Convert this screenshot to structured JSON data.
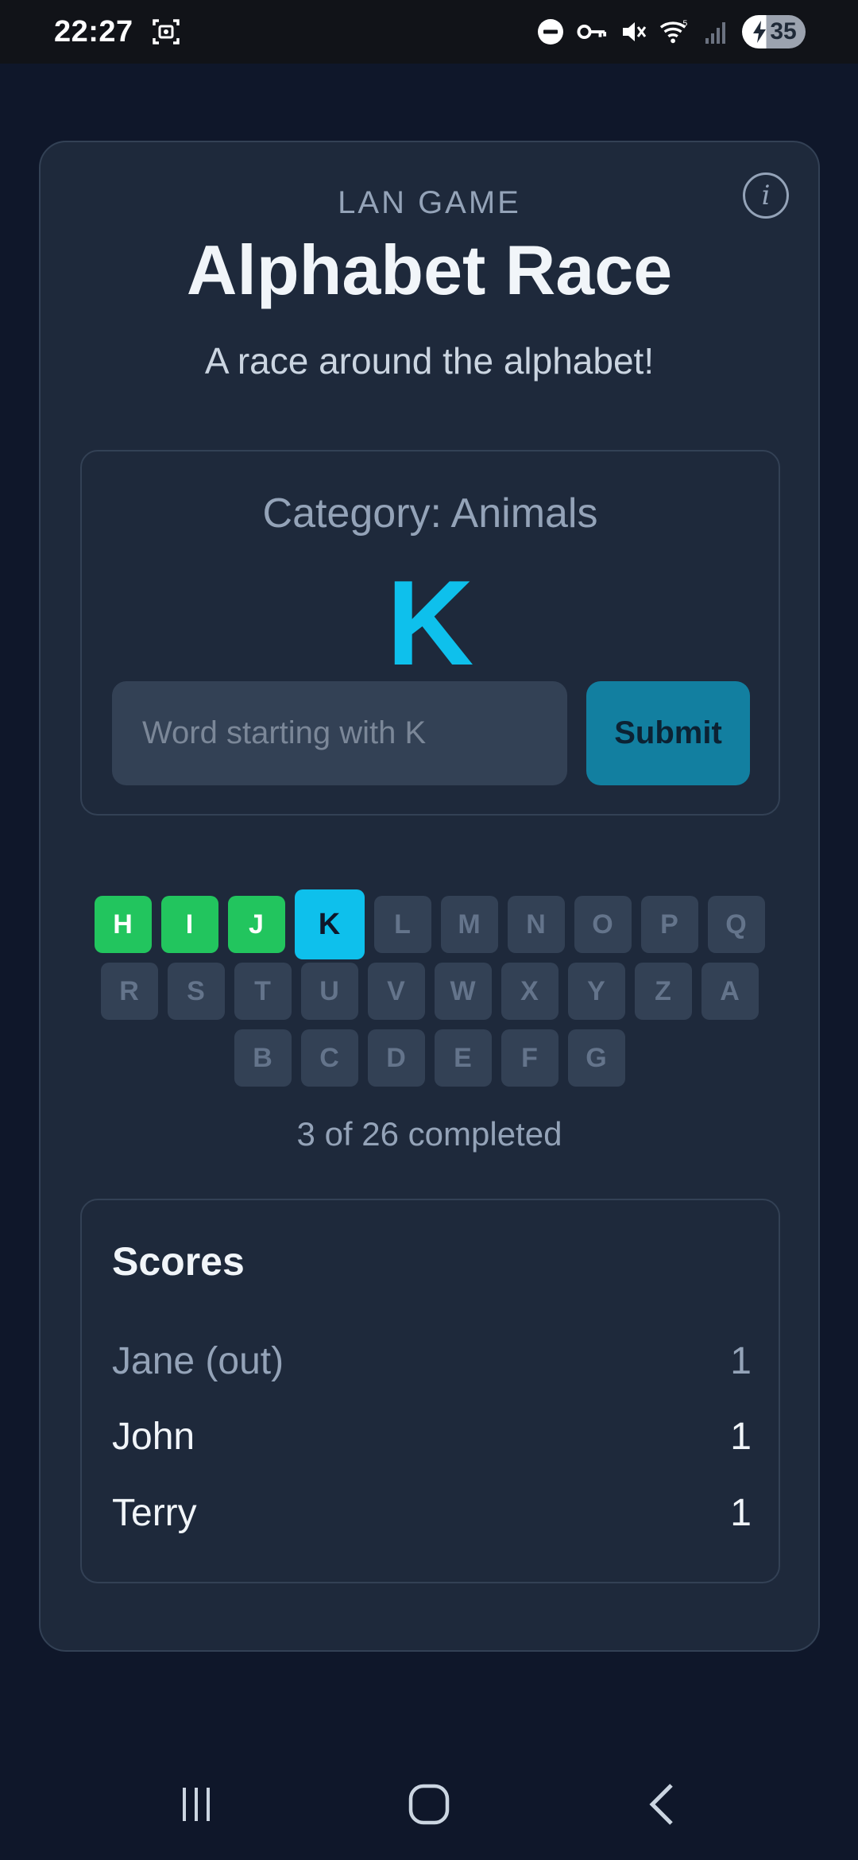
{
  "status_bar": {
    "time": "22:27",
    "battery": "35",
    "icons": [
      "screenshot-icon",
      "do-not-disturb-icon",
      "vpn-key-icon",
      "mute-icon",
      "wifi-icon",
      "signal-icon",
      "battery-charging-icon"
    ]
  },
  "header": {
    "eyebrow": "LAN GAME",
    "title": "Alphabet Race",
    "subtitle": "A race around the alphabet!",
    "info_icon": "i"
  },
  "play": {
    "category": "Category: Animals",
    "current_letter": "K",
    "input_placeholder": "Word starting with K",
    "input_value": "",
    "submit_label": "Submit"
  },
  "tracker": {
    "rows": [
      [
        {
          "letter": "H",
          "state": "done"
        },
        {
          "letter": "I",
          "state": "done"
        },
        {
          "letter": "J",
          "state": "done"
        },
        {
          "letter": "K",
          "state": "current"
        },
        {
          "letter": "L",
          "state": "pending"
        },
        {
          "letter": "M",
          "state": "pending"
        },
        {
          "letter": "N",
          "state": "pending"
        },
        {
          "letter": "O",
          "state": "pending"
        },
        {
          "letter": "P",
          "state": "pending"
        },
        {
          "letter": "Q",
          "state": "pending"
        }
      ],
      [
        {
          "letter": "R",
          "state": "pending"
        },
        {
          "letter": "S",
          "state": "pending"
        },
        {
          "letter": "T",
          "state": "pending"
        },
        {
          "letter": "U",
          "state": "pending"
        },
        {
          "letter": "V",
          "state": "pending"
        },
        {
          "letter": "W",
          "state": "pending"
        },
        {
          "letter": "X",
          "state": "pending"
        },
        {
          "letter": "Y",
          "state": "pending"
        },
        {
          "letter": "Z",
          "state": "pending"
        },
        {
          "letter": "A",
          "state": "pending"
        }
      ],
      [
        {
          "letter": "B",
          "state": "pending"
        },
        {
          "letter": "C",
          "state": "pending"
        },
        {
          "letter": "D",
          "state": "pending"
        },
        {
          "letter": "E",
          "state": "pending"
        },
        {
          "letter": "F",
          "state": "pending"
        },
        {
          "letter": "G",
          "state": "pending"
        }
      ]
    ],
    "progress_text": "3 of 26 completed"
  },
  "scores": {
    "title": "Scores",
    "players": [
      {
        "name": "Jane (out)",
        "score": "1",
        "out": true
      },
      {
        "name": "John",
        "score": "1",
        "out": false
      },
      {
        "name": "Terry",
        "score": "1",
        "out": false
      }
    ]
  },
  "colors": {
    "background": "#0f172a",
    "card": "#1e293b",
    "accent": "#0ec0ec",
    "done": "#22c55e",
    "submit": "#127fa0"
  },
  "nav_bar": {
    "icons": [
      "recent-apps-icon",
      "home-icon",
      "back-icon"
    ]
  }
}
